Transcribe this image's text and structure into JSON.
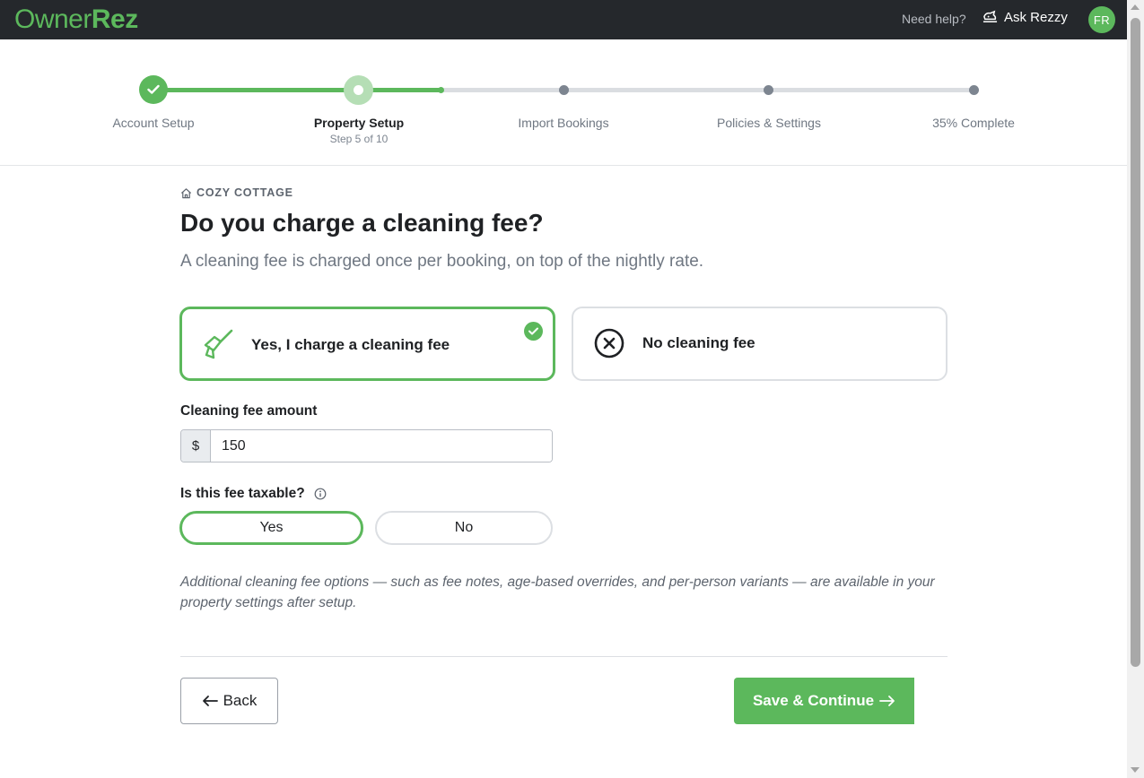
{
  "header": {
    "logo_owner": "Owner",
    "logo_rez": "Rez",
    "need_help": "Need help?",
    "ask_rezzy": "Ask Rezzy",
    "avatar_initials": "FR"
  },
  "stepper": {
    "steps": [
      {
        "label": "Account Setup",
        "state": "done"
      },
      {
        "label": "Property Setup",
        "state": "current",
        "sub": "Step 5 of 10"
      },
      {
        "label": "Import Bookings",
        "state": "todo"
      },
      {
        "label": "Policies & Settings",
        "state": "todo"
      },
      {
        "label": "35% Complete",
        "state": "todo"
      }
    ],
    "progress_percent": 35
  },
  "content": {
    "property_name": "COZY COTTAGE",
    "title": "Do you charge a cleaning fee?",
    "subtitle": "A cleaning fee is charged once per booking, on top of the nightly rate.",
    "choices": {
      "yes_label": "Yes, I charge a cleaning fee",
      "no_label": "No cleaning fee",
      "selected": "yes"
    },
    "amount": {
      "label": "Cleaning fee amount",
      "prefix": "$",
      "value": "150"
    },
    "taxable": {
      "label": "Is this fee taxable?",
      "yes_label": "Yes",
      "no_label": "No",
      "selected": "yes"
    },
    "note": "Additional cleaning fee options — such as fee notes, age-based overrides, and per-person variants — are available in your property settings after setup."
  },
  "footer": {
    "back_label": "Back",
    "save_label": "Save & Continue"
  },
  "colors": {
    "brand_green": "#5cb85c",
    "topbar_bg": "#25282c"
  }
}
